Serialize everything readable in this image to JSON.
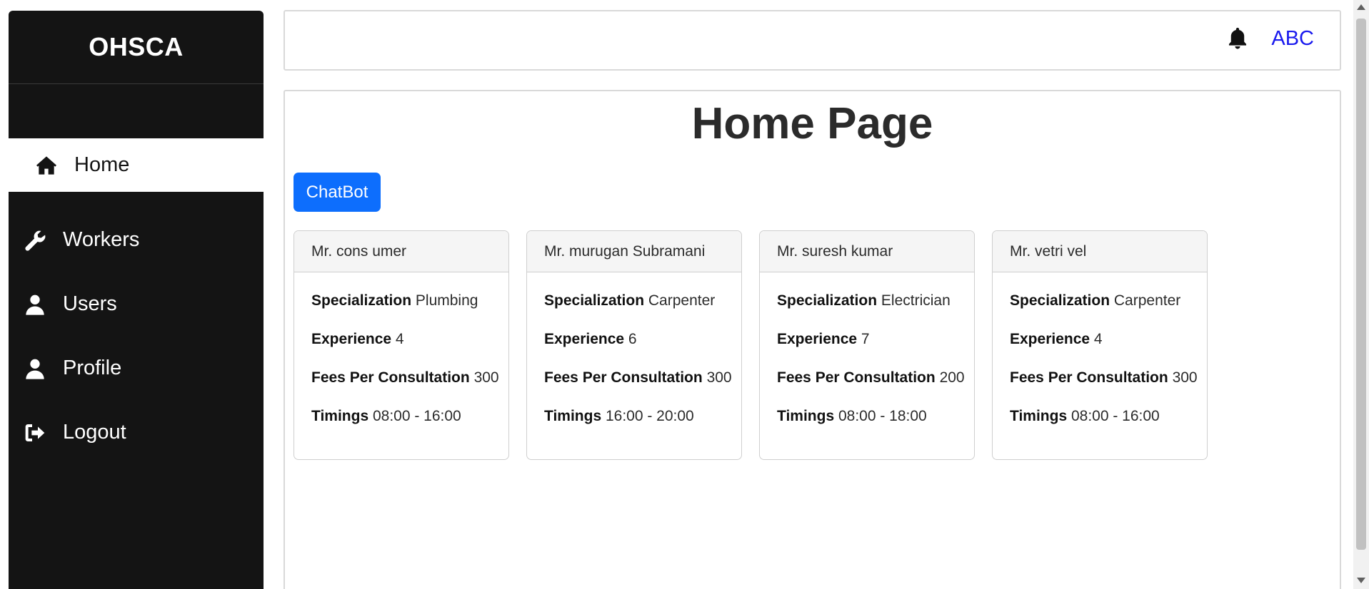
{
  "sidebar": {
    "brand": "OHSCA",
    "items": [
      {
        "label": "Home",
        "icon": "home-icon",
        "active": true
      },
      {
        "label": "Workers",
        "icon": "wrench-icon",
        "active": false
      },
      {
        "label": "Users",
        "icon": "user-icon",
        "active": false
      },
      {
        "label": "Profile",
        "icon": "user-icon",
        "active": false
      },
      {
        "label": "Logout",
        "icon": "logout-icon",
        "active": false
      }
    ]
  },
  "header": {
    "notification_icon": "bell-icon",
    "user_name": "ABC"
  },
  "main": {
    "title": "Home Page",
    "chatbot_label": "ChatBot",
    "field_labels": {
      "specialization": "Specialization",
      "experience": "Experience",
      "fees": "Fees Per Consultation",
      "timings": "Timings"
    },
    "workers": [
      {
        "name": "Mr. cons umer",
        "specialization": "Plumbing",
        "experience": "4",
        "fees": "300",
        "timings": "08:00 - 16:00"
      },
      {
        "name": "Mr. murugan Subramani",
        "specialization": "Carpenter",
        "experience": "6",
        "fees": "300",
        "timings": "16:00 - 20:00"
      },
      {
        "name": "Mr. suresh kumar",
        "specialization": "Electrician",
        "experience": "7",
        "fees": "200",
        "timings": "08:00 - 18:00"
      },
      {
        "name": "Mr. vetri vel",
        "specialization": "Carpenter",
        "experience": "4",
        "fees": "300",
        "timings": "08:00 - 16:00"
      }
    ]
  },
  "colors": {
    "sidebar_bg": "#141414",
    "primary_button": "#0d6efd",
    "user_link": "#1a1aee"
  }
}
